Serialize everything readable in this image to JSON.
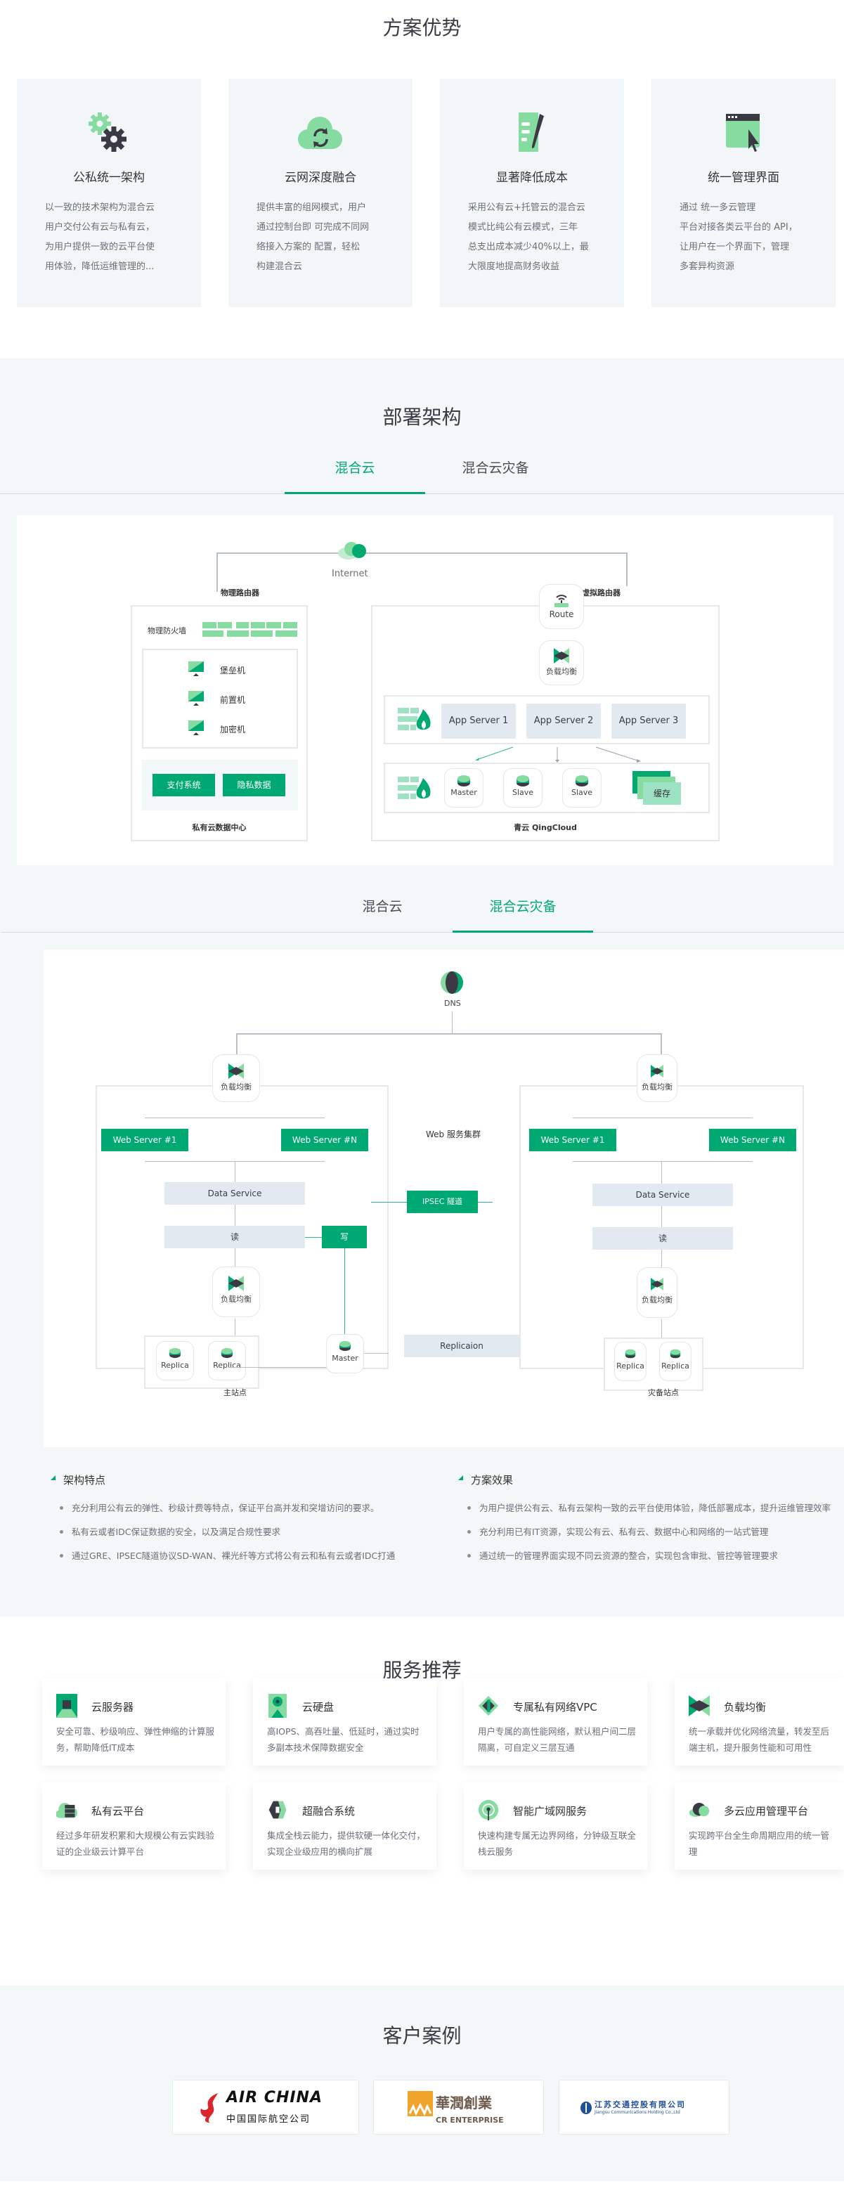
{
  "colors": {
    "accent": "#00a971",
    "accent_light": "#86dba0",
    "dark": "#3a3944",
    "panel": "#f3f6f9"
  },
  "advantages": {
    "title": "方案优势",
    "cards": [
      {
        "icon": "gears-icon",
        "title": "公私统一架构",
        "lines": [
          "以一致的技术架构为混合云",
          "用户交付公有云与私有云，",
          "为用户提供一致的云平台使",
          "用体验，降低运维管理的..."
        ]
      },
      {
        "icon": "cloud-sync-icon",
        "title": "云网深度融合",
        "lines": [
          "提供丰富的组网模式，用户",
          "通过控制台即 可完成不同网",
          "络接入方案的  配置，轻松",
          " 构建混合云"
        ]
      },
      {
        "icon": "document-pen-icon",
        "title": "显著降低成本",
        "lines": [
          "采用公有云+托管云的混合云",
          "模式比纯公有云模式，三年",
          "总支出成本减少40%以上，最",
          "大限度地提高财务收益"
        ]
      },
      {
        "icon": "window-cursor-icon",
        "title": "统一管理界面",
        "lines": [
          "通过 统一多云管理",
          "平台对接各类云平台的 API，",
          "让用户在一个界面下，管理",
          "多套异构资源"
        ]
      }
    ]
  },
  "deploy": {
    "title": "部署架构",
    "tabs1": [
      {
        "label": "混合云",
        "active": true
      },
      {
        "label": "混合云灾备",
        "active": false
      }
    ],
    "hybrid": {
      "internet": "Internet",
      "physical_router": "物理路由器",
      "virtual_router": "虚拟路由器",
      "physical_firewall": "物理防火墙",
      "machines": [
        "堡垒机",
        "前置机",
        "加密机"
      ],
      "systems": [
        "支付系统",
        "隐私数据"
      ],
      "private_dc": "私有云数据中心",
      "route": "Route",
      "lb": "负载均衡",
      "app_servers": [
        "App Server 1",
        "App Server 2",
        "App Server 3"
      ],
      "dbs": [
        "Master",
        "Slave",
        "Slave"
      ],
      "cache": "缓存",
      "qingcloud": "青云 QingCloud"
    },
    "tabs2": [
      {
        "label": "混合云",
        "active": false
      },
      {
        "label": "混合云灾备",
        "active": true
      }
    ],
    "dr": {
      "dns": "DNS",
      "lb": "负载均衡",
      "web1": "Web Server #1",
      "webn": "Web Server #N",
      "cluster": "Web 服务集群",
      "data_service": "Data Service",
      "read": "读",
      "write": "写",
      "ipsec": "IPSEC 隧道",
      "replication": "Replicaion",
      "replica": "Replica",
      "master": "Master",
      "main_site": "主站点",
      "dr_site": "灾备站点"
    },
    "features": {
      "title": "架构特点",
      "items": [
        "充分利用公有云的弹性、秒级计费等特点，保证平台高并发和突增访问的要求。",
        "私有云或者IDC保证数据的安全，以及满足合规性要求",
        "通过GRE、IPSEC隧道协议SD-WAN、裸光纤等方式将公有云和私有云或者IDC打通"
      ]
    },
    "effects": {
      "title": "方案效果",
      "items": [
        "为用户提供公有云、私有云架构一致的云平台使用体验，降低部署成本，提升运维管理效率",
        "充分利用已有IT资源，实现公有云、私有云、数据中心和网络的一站式管理",
        "通过统一的管理界面实现不同云资源的整合，实现包含审批、管控等管理要求"
      ]
    }
  },
  "services": {
    "title": "服务推荐",
    "items": [
      {
        "icon": "cloud-server-icon",
        "title": "云服务器",
        "desc": "安全可靠、秒级响应、弹性伸缩的计算服务，帮助降低IT成本"
      },
      {
        "icon": "cloud-disk-icon",
        "title": "云硬盘",
        "desc": "高IOPS、高吞吐量、低延时，通过实时多副本技术保障数据安全"
      },
      {
        "icon": "vpc-icon",
        "title": "专属私有网络VPC",
        "desc": "用户专属的高性能网络，默认租户间二层隔离，可自定义三层互通"
      },
      {
        "icon": "load-balancer-icon",
        "title": "负载均衡",
        "desc": "统一承载并优化网络流量，转发至后端主机，提升服务性能和可用性"
      },
      {
        "icon": "private-cloud-icon",
        "title": "私有云平台",
        "desc": "经过多年研发积累和大规模公有云实践验证的企业级云计算平台"
      },
      {
        "icon": "hyperconverged-icon",
        "title": "超融合系统",
        "desc": "集成全栈云能力，提供软硬一体化交付，实现企业级应用的横向扩展"
      },
      {
        "icon": "sd-wan-icon",
        "title": "智能广域网服务",
        "desc": "快速构建专属无边界网络，分钟级互联全栈云服务"
      },
      {
        "icon": "multi-cloud-icon",
        "title": "多云应用管理平台",
        "desc": "实现跨平台全生命周期应用的统一管理"
      }
    ]
  },
  "customers": {
    "title": "客户案例",
    "logos": [
      {
        "name": "AIR CHINA",
        "sub": "中国国际航空公司"
      },
      {
        "name": "華潤創業",
        "sub": "CR ENTERPRISE"
      },
      {
        "name": "江苏交通控股有限公司",
        "sub": "Jiangsu Communications Holding Co.,Ltd"
      }
    ]
  }
}
